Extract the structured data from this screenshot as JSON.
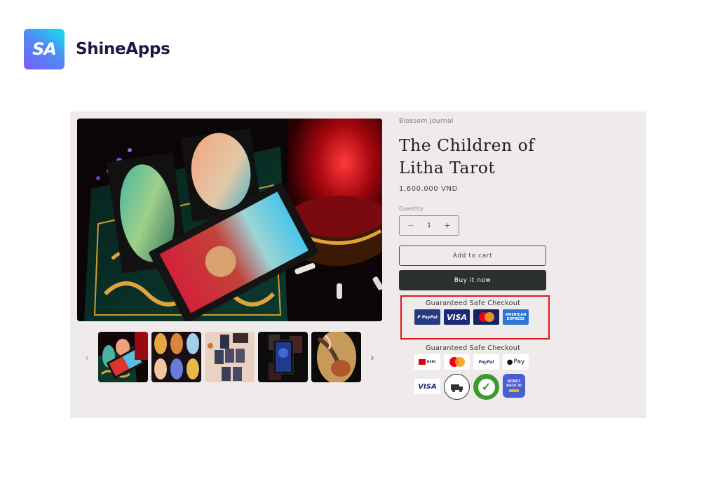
{
  "brand": {
    "logo_text": "SA",
    "name": "ShineApps"
  },
  "product": {
    "vendor": "Blossom Journal",
    "title": "The Children of Litha Tarot",
    "price": "1.600.000 VND",
    "quantity": {
      "label": "Quantity",
      "value": "1",
      "decrement": "−",
      "increment": "+"
    },
    "buttons": {
      "add_to_cart": "Add to cart",
      "buy_now": "Buy it now"
    },
    "gallery": {
      "prev_icon": "‹",
      "next_icon": "›",
      "thumbnail_count": 5
    }
  },
  "trust_badges": [
    {
      "title": "Guaranteed Safe Checkout",
      "highlighted": true,
      "highlight_color": "#e0141c",
      "items": [
        {
          "name": "PayPal",
          "text": "P PayPal"
        },
        {
          "name": "Visa",
          "text": "VISA"
        },
        {
          "name": "Mastercard",
          "text": ""
        },
        {
          "name": "American Express",
          "text": "AMERICAN EXPRESS"
        }
      ]
    },
    {
      "title": "Guaranteed Safe Checkout",
      "highlighted": false,
      "items": [
        {
          "name": "HSBC",
          "text": "HSBC"
        },
        {
          "name": "Mastercard",
          "text": ""
        },
        {
          "name": "PayPal",
          "text": "PayPal"
        },
        {
          "name": "Apple Pay",
          "text": "Pay"
        },
        {
          "name": "Visa",
          "text": "VISA"
        },
        {
          "name": "Free Shipping",
          "text": "FREE SHIPPING"
        },
        {
          "name": "Certified",
          "text": "CERTIFIED"
        },
        {
          "name": "Money Back",
          "text": "MONEY BACK 30"
        }
      ]
    }
  ],
  "colors": {
    "panel_bg": "#efebea",
    "buy_button": "#2c302d",
    "brand_text": "#1c1745"
  }
}
